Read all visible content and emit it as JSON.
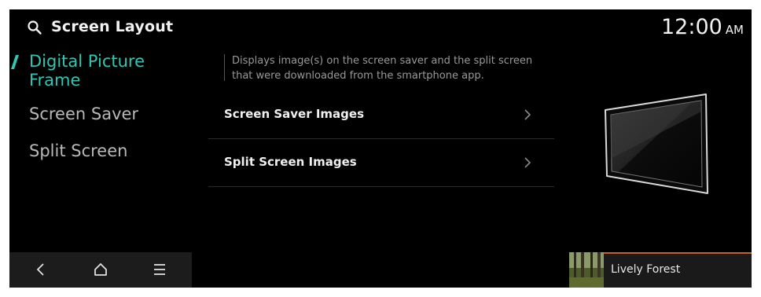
{
  "header": {
    "title": "Screen Layout",
    "clock_time": "12:00",
    "clock_ampm": "AM"
  },
  "sidebar": {
    "items": [
      {
        "label": "Digital Picture",
        "label2": "Frame",
        "active": true
      },
      {
        "label": "Screen Saver"
      },
      {
        "label": "Split Screen"
      }
    ]
  },
  "main": {
    "description_line1": "Displays image(s) on the screen saver and the split screen",
    "description_line2": "that were downloaded from the smartphone app.",
    "rows": [
      {
        "label": "Screen Saver Images"
      },
      {
        "label": "Split Screen Images"
      }
    ]
  },
  "media": {
    "title": "Lively Forest"
  },
  "colors": {
    "accent": "#2fc6b3",
    "background": "#000000",
    "media_progress": "#c4622a"
  },
  "icons": {
    "search": "search-icon",
    "back": "back-icon",
    "home": "home-icon",
    "menu": "menu-icon",
    "chevron": "chevron-right-icon",
    "device": "tablet-display-icon"
  }
}
